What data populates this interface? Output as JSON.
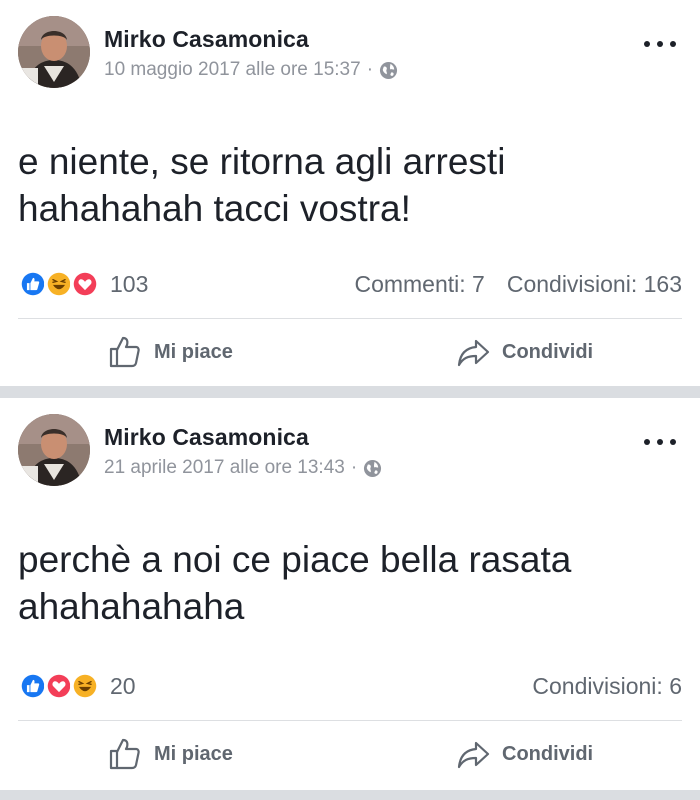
{
  "posts": [
    {
      "author": "Mirko Casamonica",
      "timestamp": "10 maggio 2017 alle ore 15:37",
      "separator": "·",
      "privacy_icon": "globe-icon",
      "message_lines": [
        "e niente, se ritorna agli arresti",
        "hahahahah tacci vostra!"
      ],
      "reactions": [
        "like",
        "haha",
        "love"
      ],
      "reaction_count": "103",
      "comments": "Commenti: 7",
      "shares": "Condivisioni: 163",
      "like_label": "Mi piace",
      "share_label": "Condividi"
    },
    {
      "author": "Mirko Casamonica",
      "timestamp": "21 aprile 2017 alle ore 13:43",
      "separator": "·",
      "privacy_icon": "globe-icon",
      "message_lines": [
        "perchè a noi ce piace bella rasata",
        "ahahahahaha"
      ],
      "reactions": [
        "like",
        "love",
        "haha"
      ],
      "reaction_count": "20",
      "comments": "",
      "shares": "Condivisioni: 6",
      "like_label": "Mi piace",
      "share_label": "Condividi"
    }
  ],
  "colors": {
    "like": "#1877f2",
    "love": "#f33e58",
    "haha": "#f7b125",
    "text": "#1d2129",
    "secondary": "#606770"
  }
}
